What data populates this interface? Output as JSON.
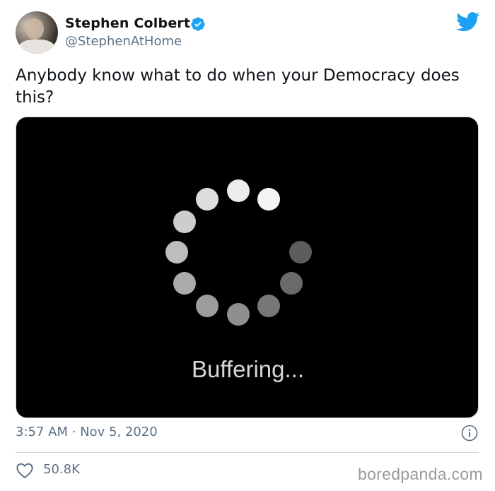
{
  "author": {
    "display_name": "Stephen Colbert",
    "handle": "@StephenAtHome"
  },
  "tweet": {
    "text": "Anybody know what to do when your Democracy does this?",
    "media_text": "Buffering...",
    "timestamp": "3:57 AM · Nov 5, 2020"
  },
  "engagement": {
    "likes": "50.8K"
  },
  "watermark": "boredpanda.com",
  "icons": {
    "verified": "verified-badge-icon",
    "brand": "twitter-bird-icon",
    "info": "info-icon",
    "like": "heart-icon"
  },
  "colors": {
    "brand": "#1da1f2",
    "text": "#0f1419",
    "secondary_text": "#5b7083",
    "media_background": "#000000"
  }
}
